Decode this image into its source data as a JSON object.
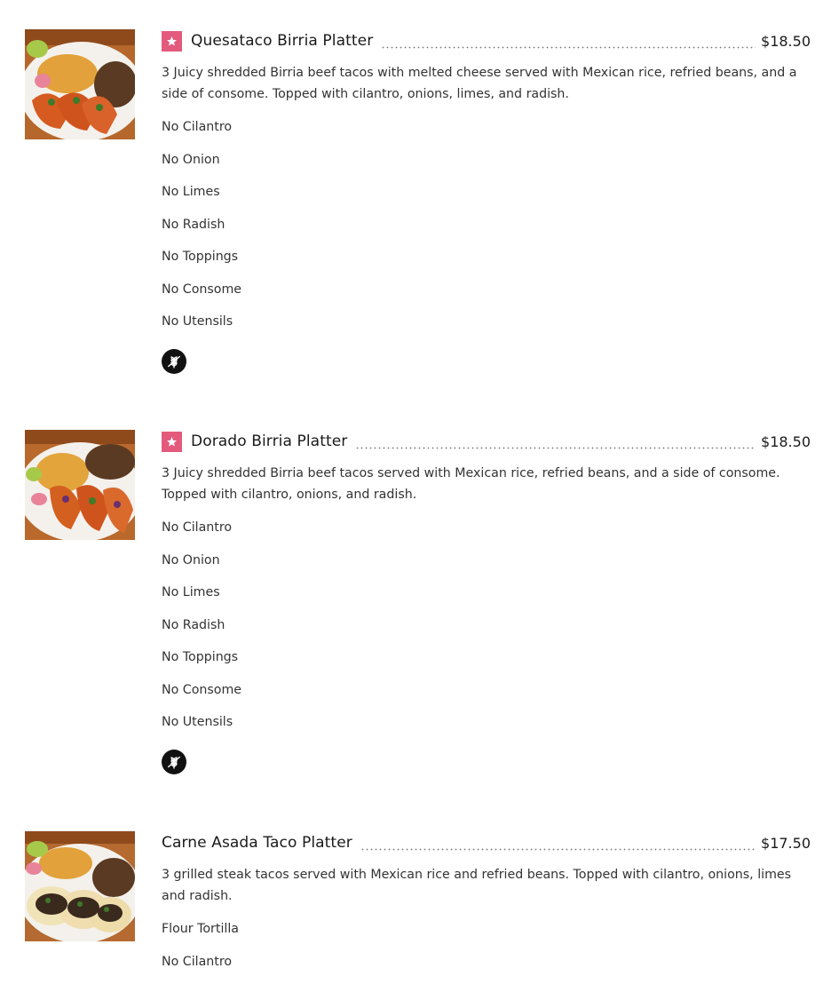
{
  "menu": {
    "items": [
      {
        "name": "Quesataco Birria Platter",
        "price": "$18.50",
        "featured": true,
        "description": "3 Juicy shredded Birria beef tacos with melted cheese served with Mexican rice, refried beans, and a side of consome. Topped with cilantro, onions, limes, and radish.",
        "options": [
          "No Cilantro",
          "No Onion",
          "No Limes",
          "No Radish",
          "No Toppings",
          "No Consome",
          "No Utensils"
        ],
        "dietary_icon": "gluten-free-icon"
      },
      {
        "name": "Dorado Birria Platter",
        "price": "$18.50",
        "featured": true,
        "description": "3 Juicy shredded Birria beef tacos served with Mexican rice, refried beans, and a side of consome. Topped with cilantro, onions, and radish.",
        "options": [
          "No Cilantro",
          "No Onion",
          "No Limes",
          "No Radish",
          "No Toppings",
          "No Consome",
          "No Utensils"
        ],
        "dietary_icon": "gluten-free-icon"
      },
      {
        "name": "Carne Asada Taco Platter",
        "price": "$17.50",
        "featured": false,
        "description": "3 grilled steak tacos served with Mexican rice and refried beans. Topped with cilantro, onions, limes and radish.",
        "options": [
          "Flour Tortilla",
          "No Cilantro"
        ]
      }
    ]
  },
  "colors": {
    "badge": "#e35a7c",
    "text": "#1a1a1a",
    "dietary_icon_bg": "#111111"
  }
}
